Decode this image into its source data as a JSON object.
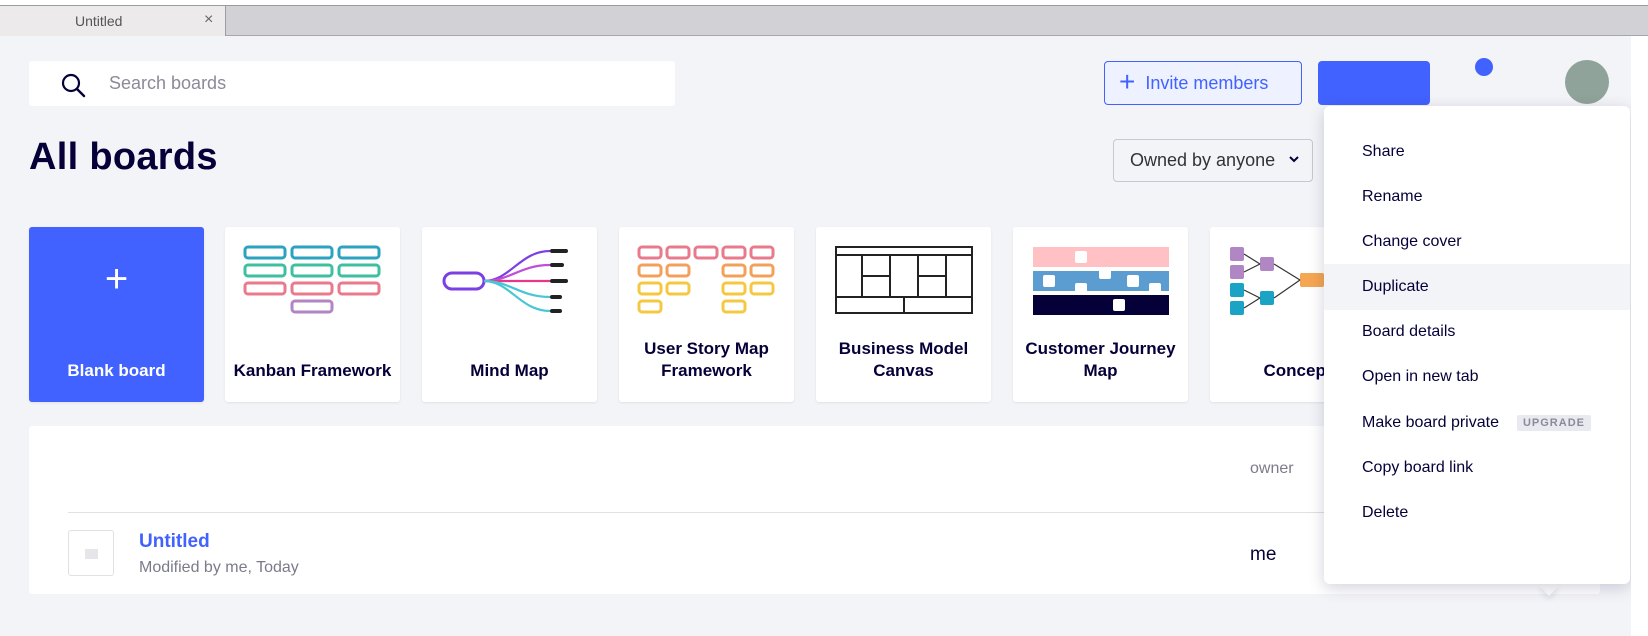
{
  "browser": {
    "tab_title": "Untitled",
    "tab_close": "×"
  },
  "header": {
    "search_placeholder": "Search boards",
    "invite_label": "Invite members",
    "invite_icon": "plus-icon"
  },
  "main": {
    "title": "All boards",
    "owner_filter": "Owned by anyone",
    "owner_filter_chevron": "⌄"
  },
  "templates": [
    {
      "label": "Blank board",
      "icon": "plus-icon"
    },
    {
      "label": "Kanban Framework"
    },
    {
      "label": "Mind Map"
    },
    {
      "label": "User Story Map Framework"
    },
    {
      "label": "Business Model Canvas"
    },
    {
      "label": "Customer Journey Map"
    },
    {
      "label": "Concept"
    }
  ],
  "board_list": {
    "column_owner": "owner",
    "rows": [
      {
        "title": "Untitled",
        "subtitle": "Modified by me, Today",
        "owner": "me",
        "star_icon": "☆",
        "more_icon": "•••"
      }
    ]
  },
  "context_menu": {
    "items": [
      {
        "label": "Share"
      },
      {
        "label": "Rename"
      },
      {
        "label": "Change cover"
      },
      {
        "label": "Duplicate"
      },
      {
        "label": "Board details"
      },
      {
        "label": "Open in new tab"
      },
      {
        "label": "Make board private",
        "tag": "UPGRADE"
      },
      {
        "label": "Copy board link"
      },
      {
        "label": "Delete"
      }
    ],
    "hovered_item": "Duplicate"
  },
  "colors": {
    "accent": "#4262ff",
    "text": "#050038",
    "background": "#f3f4f8"
  }
}
